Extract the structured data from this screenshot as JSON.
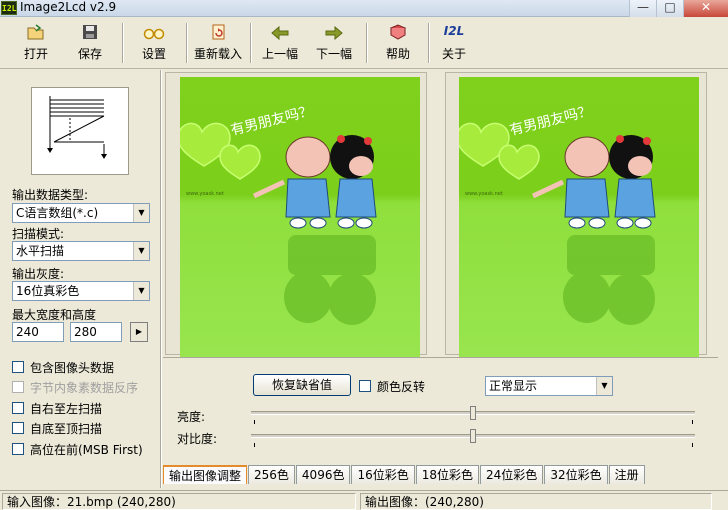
{
  "window": {
    "app_icon_text": "I2L",
    "title": "Image2Lcd v2.9",
    "minimize": "—",
    "maximize": "□",
    "close": "✕"
  },
  "toolbar": {
    "open": "打开",
    "save": "保存",
    "settings": "设置",
    "reload": "重新载入",
    "prev": "上一幅",
    "next": "下一幅",
    "help": "帮助",
    "about_icon": "I2L",
    "about": "关于"
  },
  "left": {
    "output_type_label": "输出数据类型:",
    "output_type_value": "C语言数组(*.c)",
    "scan_mode_label": "扫描模式:",
    "scan_mode_value": "水平扫描",
    "gray_label": "输出灰度:",
    "gray_value": "16位真彩色",
    "max_size_label": "最大宽度和高度",
    "max_width": "240",
    "max_height": "280",
    "checkboxes": [
      {
        "label": "包含图像头数据",
        "checked": false,
        "enabled": true
      },
      {
        "label": "字节内象素数据反序",
        "checked": false,
        "enabled": false
      },
      {
        "label": "自右至左扫描",
        "checked": false,
        "enabled": true
      },
      {
        "label": "自底至顶扫描",
        "checked": false,
        "enabled": true
      },
      {
        "label": "高位在前(MSB First)",
        "checked": false,
        "enabled": true
      }
    ]
  },
  "image": {
    "caption_text": "有男朋友吗？",
    "watermark": "www.yoask.net"
  },
  "controls": {
    "restore_default": "恢复缺省值",
    "invert_color_label": "颜色反转",
    "display_mode_value": "正常显示",
    "brightness_label": "亮度:",
    "brightness_level": 0.5,
    "contrast_label": "对比度:",
    "contrast_level": 0.5
  },
  "tabs": [
    "输出图像调整",
    "256色",
    "4096色",
    "16位彩色",
    "18位彩色",
    "24位彩色",
    "32位彩色",
    "注册"
  ],
  "status": {
    "input": "输入图像：21.bmp (240,280)",
    "output": "输出图像：(240,280)"
  },
  "colors": {
    "image_green": "#7fd11c",
    "heart_green": "#b6f24a",
    "boy_skin": "#f3c3b6",
    "overalls_blue": "#5aa2e0",
    "active_tab_orange": "#e68b2c"
  }
}
